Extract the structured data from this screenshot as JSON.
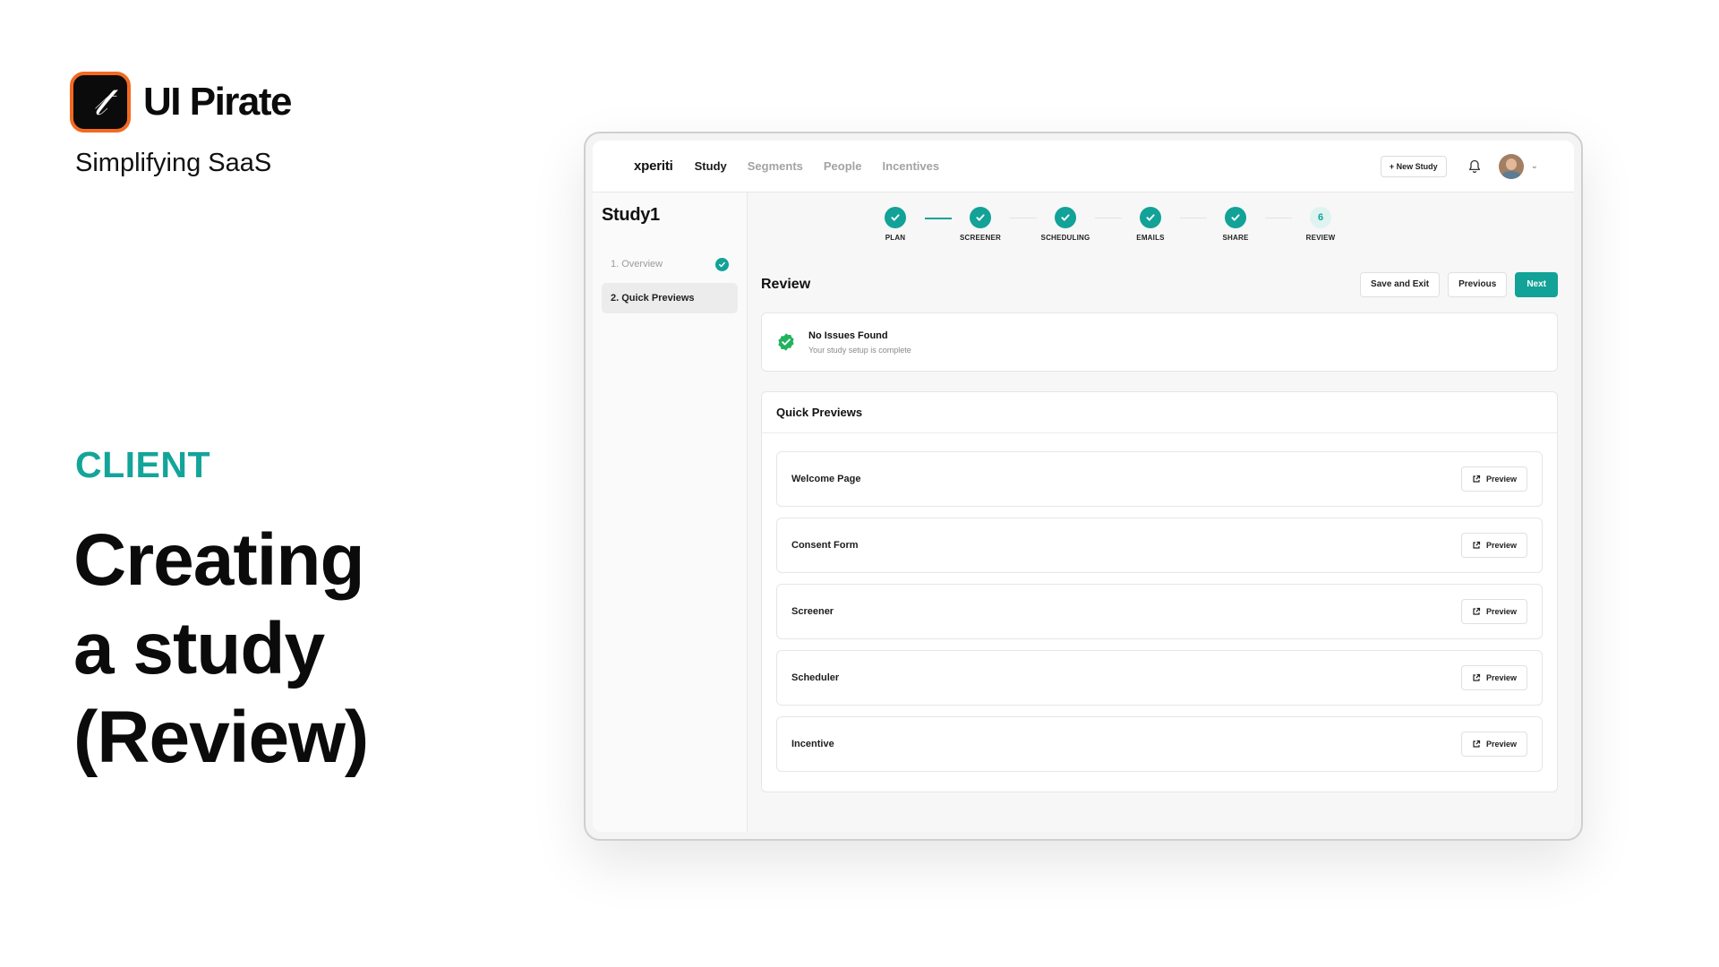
{
  "brand": {
    "logo_glyph": "𝓉",
    "name": "UI Pirate",
    "tagline": "Simplifying SaaS",
    "accent": "#f26a21"
  },
  "slide": {
    "category": "CLIENT",
    "headline": [
      "Creating",
      "a study",
      "(Review)"
    ],
    "category_color": "#13a49a"
  },
  "app": {
    "logo": "xperiti",
    "nav": [
      "Study",
      "Segments",
      "People",
      "Incentives"
    ],
    "active_nav": "Study",
    "new_study_label": "+ New Study",
    "icons": {
      "notifications": "bell-icon",
      "profile": "avatar",
      "menu": "chevron-down-icon"
    },
    "sidebar": {
      "title": "Study1",
      "items": [
        {
          "label": "1. Overview",
          "state": "complete"
        },
        {
          "label": "2. Quick Previews",
          "state": "active"
        }
      ]
    },
    "stepper": {
      "steps": [
        {
          "label": "PLAN",
          "state": "done"
        },
        {
          "label": "SCREENER",
          "state": "done"
        },
        {
          "label": "SCHEDULING",
          "state": "done"
        },
        {
          "label": "EMAILS",
          "state": "done"
        },
        {
          "label": "SHARE",
          "state": "done"
        },
        {
          "label": "REVIEW",
          "state": "current",
          "number": "6"
        }
      ]
    },
    "review": {
      "title": "Review",
      "save_exit_label": "Save and Exit",
      "previous_label": "Previous",
      "next_label": "Next"
    },
    "status": {
      "title": "No Issues Found",
      "subtitle": "Your study setup is complete"
    },
    "quick_previews": {
      "title": "Quick Previews",
      "button_label": "Preview",
      "items": [
        "Welcome Page",
        "Consent Form",
        "Screener",
        "Scheduler",
        "Incentive"
      ]
    },
    "colors": {
      "primary": "#12a297"
    }
  }
}
